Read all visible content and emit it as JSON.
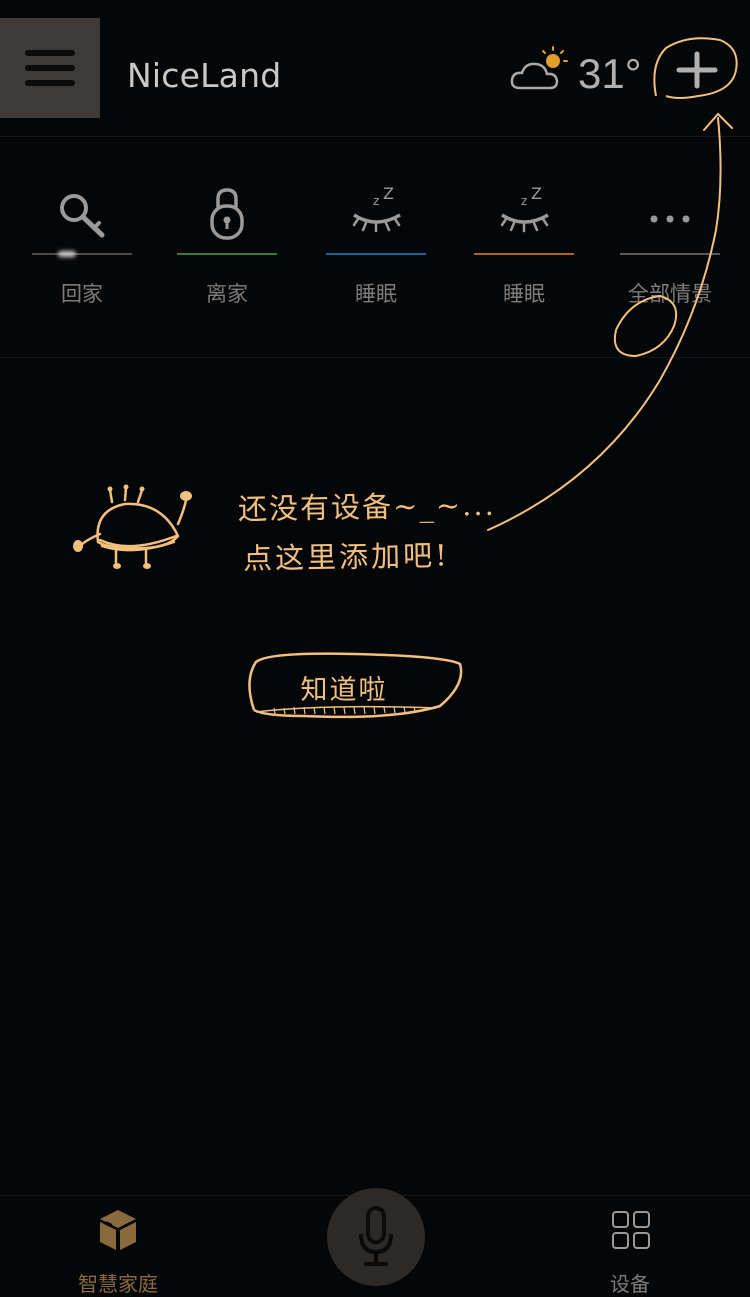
{
  "header": {
    "title": "NiceLand",
    "temperature": "31°",
    "weather_icon": "partly-cloudy-icon",
    "menu_icon": "hamburger-menu-icon",
    "add_icon": "plus-icon"
  },
  "scenes": [
    {
      "label": "回家",
      "icon": "key-icon",
      "color": "#6a6a6a"
    },
    {
      "label": "离家",
      "icon": "lock-icon",
      "color": "#3e7a33"
    },
    {
      "label": "睡眠",
      "icon": "sleep-icon",
      "color": "#1f5f95"
    },
    {
      "label": "睡眠",
      "icon": "sleep-icon",
      "color": "#a8661a"
    },
    {
      "label": "全部情景",
      "icon": "more-icon",
      "color": "#5a5a5a"
    }
  ],
  "guide": {
    "line1": "还没有设备~_~...",
    "line2": "点这里添加吧!",
    "ok_label": "知道啦",
    "accent_color": "#f2c07e"
  },
  "bottom_nav": {
    "home_label": "智慧家庭",
    "devices_label": "设备",
    "home_color": "#8a6a3c"
  }
}
